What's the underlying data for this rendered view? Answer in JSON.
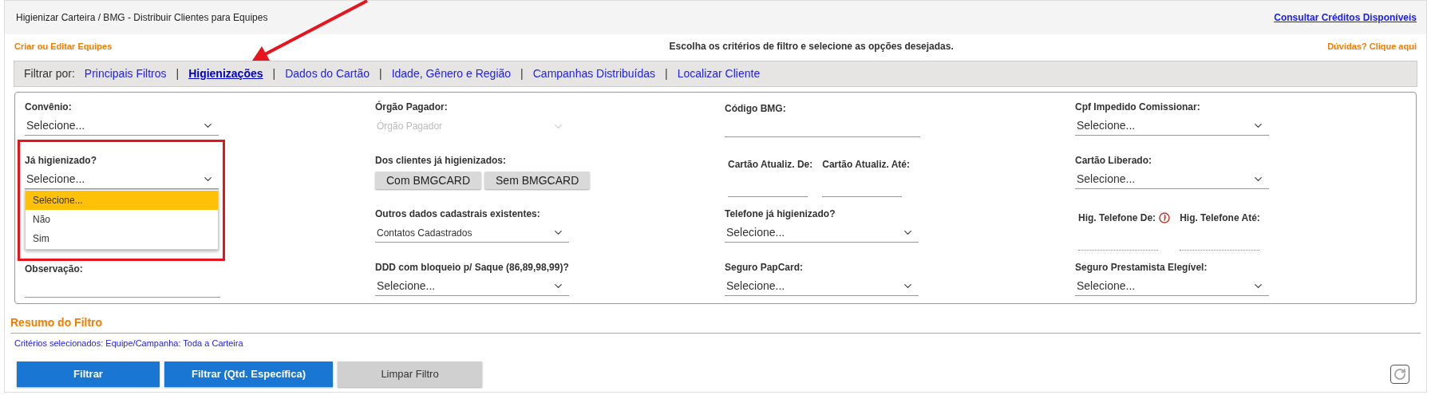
{
  "header": {
    "breadcrumb": "Higienizar Carteira / BMG - Distribuir Clientes para Equipes",
    "credits_link": "Consultar Créditos Disponíveis"
  },
  "subheader": {
    "left_link": "Criar ou Editar Equipes",
    "instruction": "Escolha os critérios de filtro e selecione as opções desejadas.",
    "help_link": "Dúvidas? Clique aqui"
  },
  "filter_bar": {
    "label": "Filtrar por:",
    "items": [
      {
        "kind": "tab",
        "label": "Principais Filtros",
        "selected": false
      },
      {
        "kind": "separator",
        "text": "|"
      },
      {
        "kind": "tab",
        "label": "Higienizações",
        "selected": true
      },
      {
        "kind": "separator",
        "text": "|"
      },
      {
        "kind": "tab",
        "label": "Dados do Cartão",
        "selected": false
      },
      {
        "kind": "separator",
        "text": "|"
      },
      {
        "kind": "tab",
        "label": "Idade, Gênero e Região",
        "selected": false
      },
      {
        "kind": "separator",
        "text": "|"
      },
      {
        "kind": "tab",
        "label": "Campanhas Distribuídas",
        "selected": false
      },
      {
        "kind": "separator",
        "text": "|"
      },
      {
        "kind": "tab",
        "label": "Localizar Cliente",
        "selected": false
      }
    ]
  },
  "form_rows": [
    [
      {
        "kind": "select",
        "label": "Convênio:",
        "value": "Selecione...",
        "disabled": false
      },
      {
        "kind": "select",
        "label": "Órgão Pagador:",
        "placeholder": "Órgão Pagador",
        "disabled": true
      },
      {
        "kind": "text",
        "label": "Código BMG:"
      },
      {
        "kind": "select",
        "label": "Cpf Impedido Comissionar:",
        "value": "Selecione...",
        "disabled": false
      }
    ],
    [
      {
        "kind": "select",
        "label": "Já higienizado?",
        "value": "Selecione...",
        "disabled": false,
        "open": true,
        "options": [
          {
            "label": "Selecione...",
            "selected": true
          },
          {
            "label": "Não",
            "selected": false
          },
          {
            "label": "Sim",
            "selected": false
          }
        ]
      },
      {
        "kind": "buttons",
        "label": "Dos clientes já higienizados:",
        "buttons": [
          "Com BMGCARD",
          "Sem BMGCARD"
        ]
      },
      {
        "kind": "range",
        "from_label": "Cartão Atualiz. De:",
        "to_label": "Cartão Atualiz. Até:",
        "info": false
      },
      {
        "kind": "select",
        "label": "Cartão Liberado:",
        "value": "Selecione...",
        "disabled": false
      }
    ],
    [
      {
        "kind": "blank"
      },
      {
        "kind": "select",
        "label": "Outros dados cadastrais existentes:",
        "value": "Contatos Cadastrados",
        "disabled": false
      },
      {
        "kind": "select",
        "label": "Telefone já higienizado?",
        "value": "Selecione...",
        "disabled": false
      },
      {
        "kind": "range",
        "from_label": "Hig. Telefone De:",
        "to_label": "Hig. Telefone Até:",
        "info": true
      }
    ],
    [
      {
        "kind": "text",
        "label": "Observação:"
      },
      {
        "kind": "select",
        "label": "DDD com bloqueio p/ Saque (86,89,98,99)?",
        "value": "Selecione...",
        "disabled": false
      },
      {
        "kind": "select",
        "label": "Seguro PapCard:",
        "value": "Selecione...",
        "disabled": false
      },
      {
        "kind": "select",
        "label": "Seguro Prestamista Elegível:",
        "value": "Selecione...",
        "disabled": false
      }
    ]
  ],
  "summary": {
    "title": "Resumo do Filtro",
    "criteria": "Critérios selecionados: Equipe/Campanha: Toda a Carteira"
  },
  "actions": [
    {
      "kind": "primary",
      "label": "Filtrar"
    },
    {
      "kind": "primary",
      "label": "Filtrar (Qtd. Específica)"
    },
    {
      "kind": "secondary",
      "label": "Limpar Filtro"
    }
  ]
}
